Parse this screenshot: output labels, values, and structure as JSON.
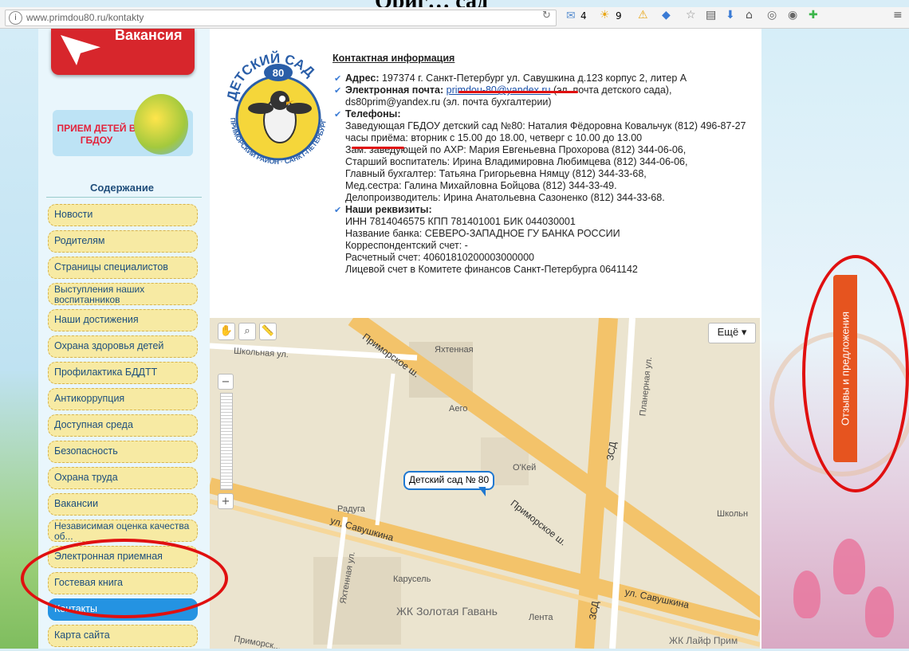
{
  "doc_title": "Ориг… сад",
  "browser": {
    "url": "www.primdou80.ru/kontakty",
    "mail_count": "4",
    "weather_temp": "9"
  },
  "sidebar": {
    "banner_vacancy": "Вакансия",
    "banner_priem": "ПРИЕМ ДЕТЕЙ В ГБДОУ",
    "menu_title": "Содержание",
    "items": [
      "Новости",
      "Родителям",
      "Страницы специалистов",
      "Выступления наших воспитанников",
      "Наши достижения",
      "Охрана здоровья детей",
      "Профилактика БДДТТ",
      "Антикоррупция",
      "Доступная среда",
      "Безопасность",
      "Охрана труда",
      "Вакансии",
      "Независимая оценка качества об...",
      "Электронная приемная",
      "Гостевая книга",
      "Контакты",
      "Карта сайта"
    ],
    "active_index": 15
  },
  "logo": {
    "top_text": "ДЕТСКИЙ САД",
    "number": "80",
    "ring_text": "ПРИМОРСКИЙ РАЙОН · САНКТ-ПЕТЕРБУРГ"
  },
  "contacts": {
    "title": "Контактная информация",
    "address_label": "Адрес:",
    "address": "197374 г. Санкт-Петербург ул. Савушкина д.123 корпус 2, литер А",
    "email_label": "Электронная почта:",
    "email1": "primdou-80@yandex.ru",
    "email1_note": "(эл. почта детского сада),",
    "email2": "ds80prim@yandex.ru",
    "email2_note": "(эл. почта бухгалтерии)",
    "phones_label": "Телефоны:",
    "phone_lines": [
      "Заведующая ГБДОУ детский сад №80: Наталия Фёдоровна Ковальчук (812) 496-87-27",
      "часы приёма: вторник с 15.00 до 18.00, четверг с 10.00 до 13.00",
      "Зам. заведующей по АХР: Мария Евгеньевна Прохорова (812) 344-06-06,",
      "Старший воспитатель: Ирина Владимировна Любимцева (812) 344-06-06,",
      "Главный бухгалтер: Татьяна Григорьевна Нямцу (812) 344-33-68,",
      "Мед.сестра: Галина Михайловна Бойцова (812) 344-33-49.",
      "Делопроизводитель: Ирина Анатольевна Сазоненко (812) 344-33-68."
    ],
    "req_label": "Наши реквизиты:",
    "req_lines": [
      "ИНН 7814046575 КПП 781401001 БИК 044030001",
      "Название банка: СЕВЕРО-ЗАПАДНОЕ ГУ БАНКА РОССИИ",
      "Корреспондентский счет: -",
      "Расчетный счет: 40601810200003000000",
      "Лицевой счет в Комитете финансов Санкт-Петербурга 0641142"
    ]
  },
  "map": {
    "more_button": "Ещё ▾",
    "marker": "Детский сад № 80",
    "labels": {
      "kolnaya": "Школьная ул.",
      "primorskoe1": "Приморское ш.",
      "primorskoe2": "Приморское ш.",
      "primorskoe3": "Приморск...",
      "yakhtennaya_st": "Яхтенная",
      "aego": "Аего",
      "okey": "О'Кей",
      "raduga": "Радуга",
      "savushkina1": "ул. Савушкина",
      "savushkina2": "ул. Савушкина",
      "yakhtennaya_ul": "Яхтенная ул.",
      "karusel": "Карусель",
      "zolotaya": "ЖК Золотая Гавань",
      "lenta": "Лента",
      "zsd1": "ЗСД",
      "zsd2": "ЗСД",
      "planernaya": "Планерная ул.",
      "shkolnaya_right": "Школьн",
      "laif": "ЖК Лайф Прим"
    }
  },
  "feedback_tab": "Отзывы и предложения",
  "colors": {
    "accent_red": "#e01010",
    "menu_active": "#2493e2",
    "menu_item": "#f7eaa3",
    "feedback": "#e6541f"
  }
}
